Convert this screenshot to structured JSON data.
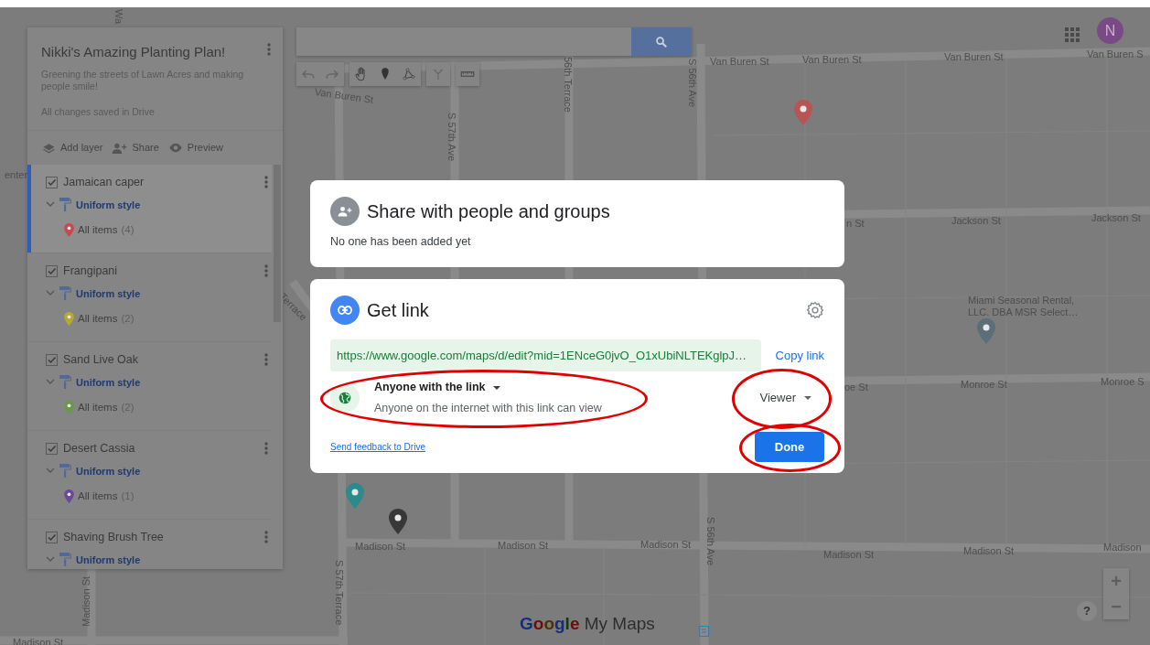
{
  "map": {
    "labels": [
      "Van Buren St",
      "Van Buren St",
      "Van Buren St",
      "Van Buren St",
      "Van Buren S",
      "56th Terrace",
      "S 56th Ave",
      "S 57th Ave",
      "n St",
      "Jackson St",
      "Jackson St",
      "Miami Seasonal Rental, LLC. DBA MSR Select…",
      "oe St",
      "Monroe St",
      "Monroe S",
      "Madison St",
      "Madison St",
      "Madison St",
      "Madison St",
      "Madison St",
      "Madison",
      "S 56th Ave",
      "S 57th Terrace",
      "Madison St",
      "Madison St",
      "Terrace",
      "enter",
      "Wa"
    ],
    "pins": [
      {
        "color": "#b85454"
      },
      {
        "color": "#5c6e78"
      },
      {
        "color": "#2a8a8c"
      },
      {
        "color": "#383838"
      }
    ]
  },
  "account": {
    "initial": "N"
  },
  "sidebar": {
    "title": "Nikki's Amazing Planting Plan!",
    "description": "Greening the streets of Lawn Acres and making people smile!",
    "save_status": "All changes saved in Drive",
    "actions": [
      "Add layer",
      "Share",
      "Preview"
    ],
    "layers": [
      {
        "name": "Jamaican caper",
        "checked": true,
        "selected": true,
        "style": "Uniform style",
        "items": "All items",
        "count": "(4)",
        "color": "#c84a4a"
      },
      {
        "name": "Frangipani",
        "checked": true,
        "selected": false,
        "style": "Uniform style",
        "items": "All items",
        "count": "(2)",
        "color": "#b8a830"
      },
      {
        "name": "Sand Live Oak",
        "checked": true,
        "selected": false,
        "style": "Uniform style",
        "items": "All items",
        "count": "(2)",
        "color": "#6a9a48"
      },
      {
        "name": "Desert Cassia",
        "checked": true,
        "selected": false,
        "style": "Uniform style",
        "items": "All items",
        "count": "(1)",
        "color": "#6a4a98"
      },
      {
        "name": "Shaving Brush Tree",
        "checked": true,
        "selected": false,
        "style": "Uniform style"
      }
    ]
  },
  "dialog": {
    "people": {
      "title": "Share with people and groups",
      "status": "No one has been added yet"
    },
    "link": {
      "title": "Get link",
      "url": "https://www.google.com/maps/d/edit?mid=1ENceG0jvO_O1xUbiNLTEKglpJ…",
      "copy": "Copy link",
      "access": {
        "label": "Anyone with the link",
        "description": "Anyone on the internet with this link can view",
        "highlighted": true
      },
      "role": {
        "label": "Viewer",
        "highlighted": true
      },
      "feedback": "Send feedback to Drive",
      "done": {
        "label": "Done",
        "highlighted": true
      }
    }
  },
  "footer": {
    "logo": "Google",
    "product": "My Maps",
    "help": "?",
    "zoom_in": "+",
    "zoom_out": "−"
  }
}
